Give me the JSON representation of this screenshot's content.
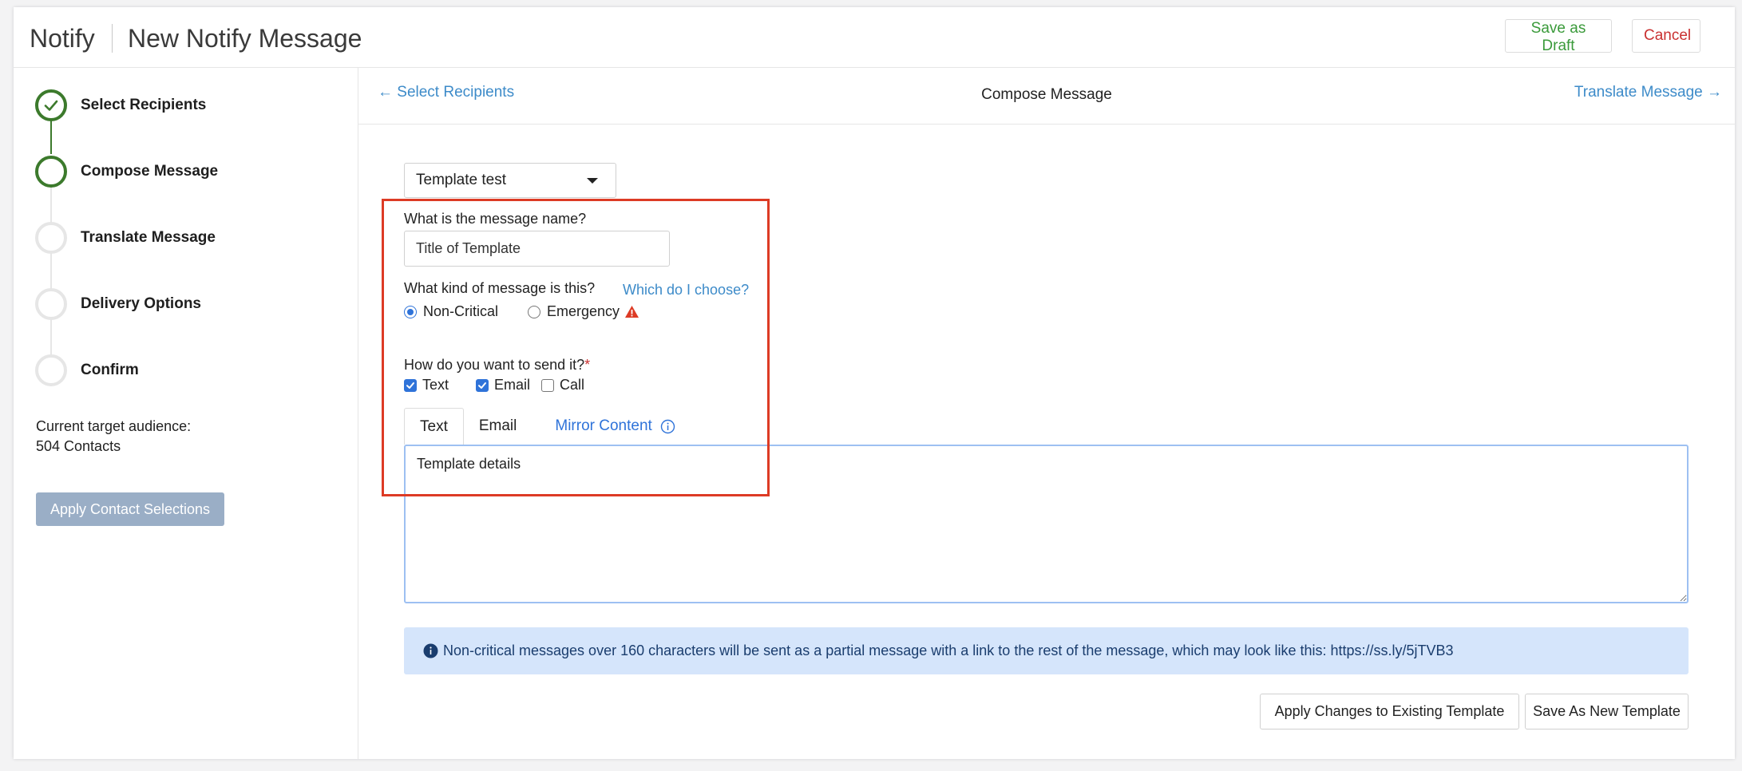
{
  "header": {
    "app_title": "Notify",
    "page_title": "New Notify Message",
    "save_draft_label": "Save as Draft",
    "cancel_label": "Cancel"
  },
  "wizard": {
    "steps": [
      {
        "label": "Select Recipients",
        "state": "done"
      },
      {
        "label": "Compose Message",
        "state": "active"
      },
      {
        "label": "Translate Message",
        "state": "pending"
      },
      {
        "label": "Delivery Options",
        "state": "pending"
      },
      {
        "label": "Confirm",
        "state": "pending"
      }
    ],
    "audience_label": "Current target audience:",
    "audience_count": "504 Contacts",
    "apply_contacts_label": "Apply Contact Selections"
  },
  "nav": {
    "prev_label": "← Select Recipients",
    "current_label": "Compose Message",
    "next_label": "Translate Message →"
  },
  "form": {
    "template_selected": "Template test",
    "name_question": "What is the message name?",
    "name_value": "Title of Template",
    "kind_question": "What kind of message is this?",
    "kind_help_link": "Which do I choose?",
    "kind_options": [
      {
        "label": "Non-Critical",
        "checked": true
      },
      {
        "label": "Emergency",
        "checked": false
      }
    ],
    "send_question": "How do you want to send it?",
    "required_mark": "*",
    "send_options": [
      {
        "label": "Text",
        "checked": true
      },
      {
        "label": "Email",
        "checked": true
      },
      {
        "label": "Call",
        "checked": false
      }
    ],
    "tabs": [
      {
        "label": "Text",
        "active": true
      },
      {
        "label": "Email",
        "active": false
      },
      {
        "label": "Mirror Content",
        "active": false
      }
    ],
    "message_body": "Template details",
    "info_text": "Non-critical messages over 160 characters will be sent as a partial message with a link to the rest of the message, which may look like this: https://ss.ly/5jTVB3",
    "apply_existing_label": "Apply Changes to Existing Template",
    "save_new_label": "Save As New Template"
  },
  "colors": {
    "brand_green": "#3c7a2c",
    "link_blue": "#3d8bc9",
    "accent_blue": "#2f73d9",
    "danger_red": "#c93131",
    "highlight_red": "#dd3b25",
    "info_bg": "#d5e5fb"
  }
}
